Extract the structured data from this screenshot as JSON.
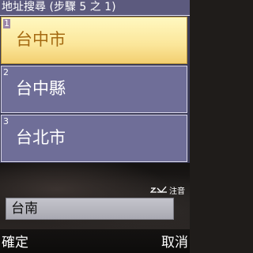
{
  "header": {
    "title": "地址搜尋 (步驟 5 之 1)"
  },
  "list": {
    "items": [
      {
        "number": "1",
        "label": "台中市",
        "selected": true
      },
      {
        "number": "2",
        "label": "台中縣",
        "selected": false
      },
      {
        "number": "3",
        "label": "台北市",
        "selected": false
      }
    ]
  },
  "input": {
    "mode_indicator": "注音",
    "mode_icon": "input-mode-icon",
    "value": "台南"
  },
  "softkeys": {
    "left": "確定",
    "right": "取消"
  },
  "colors": {
    "title_bar": "#5c5a7e",
    "item_background": "#6f6e98",
    "selected_item_background": "#fbe69a",
    "selected_text": "#a56a12"
  }
}
